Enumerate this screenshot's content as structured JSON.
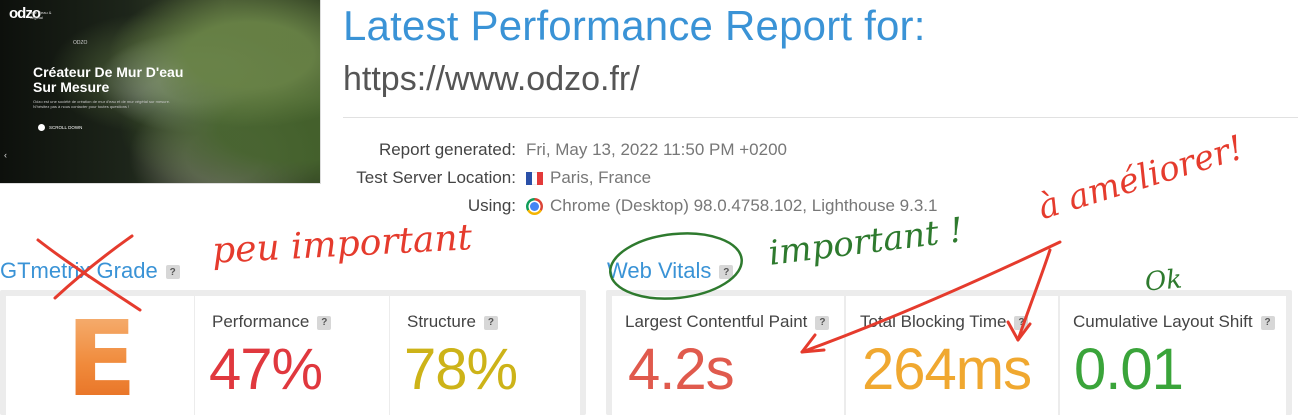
{
  "thumbnail": {
    "logo": "odzo",
    "logo_tagline": "mur d'eau & végétal",
    "nav": "ODZO",
    "heading_line1": "Créateur De Mur D'eau",
    "heading_line2": "Sur Mesure",
    "paragraph": "Odzo est une société de création de mur d'eau et de mur végétal sur mesure. N'hésitez pas à nous contacter pour toutes questions !",
    "cta": "SCROLL DOWN",
    "arrow": "‹"
  },
  "header": {
    "title": "Latest Performance Report for:",
    "url": "https://www.odzo.fr/"
  },
  "meta": {
    "generated_label": "Report generated:",
    "generated_value": "Fri, May 13, 2022 11:50 PM +0200",
    "location_label": "Test Server Location:",
    "location_value": "Paris, France",
    "using_label": "Using:",
    "using_value": "Chrome (Desktop) 98.0.4758.102, Lighthouse 9.3.1"
  },
  "gtmetrix": {
    "title": "GTmetrix Grade",
    "help": "?",
    "grade": "E",
    "performance_label": "Performance",
    "performance_value": "47%",
    "structure_label": "Structure",
    "structure_value": "78%"
  },
  "web_vitals": {
    "title": "Web Vitals",
    "help": "?",
    "lcp_label": "Largest Contentful Paint",
    "lcp_value": "4.2s",
    "tbt_label": "Total Blocking Time",
    "tbt_value": "264ms",
    "cls_label": "Cumulative Layout Shift",
    "cls_value": "0.01"
  },
  "annotations": {
    "peu_important": "peu important",
    "important": "important !",
    "a_ameliorer": "à améliorer!",
    "ok": "Ok"
  },
  "colors": {
    "blue": "#3a93d6",
    "red": "#e0383e",
    "yellow": "#cdb318",
    "salmon": "#e05a4d",
    "orange": "#f0a830",
    "green": "#3aa43a",
    "ink_red": "#e53b2d",
    "ink_green": "#2e7a2e"
  }
}
